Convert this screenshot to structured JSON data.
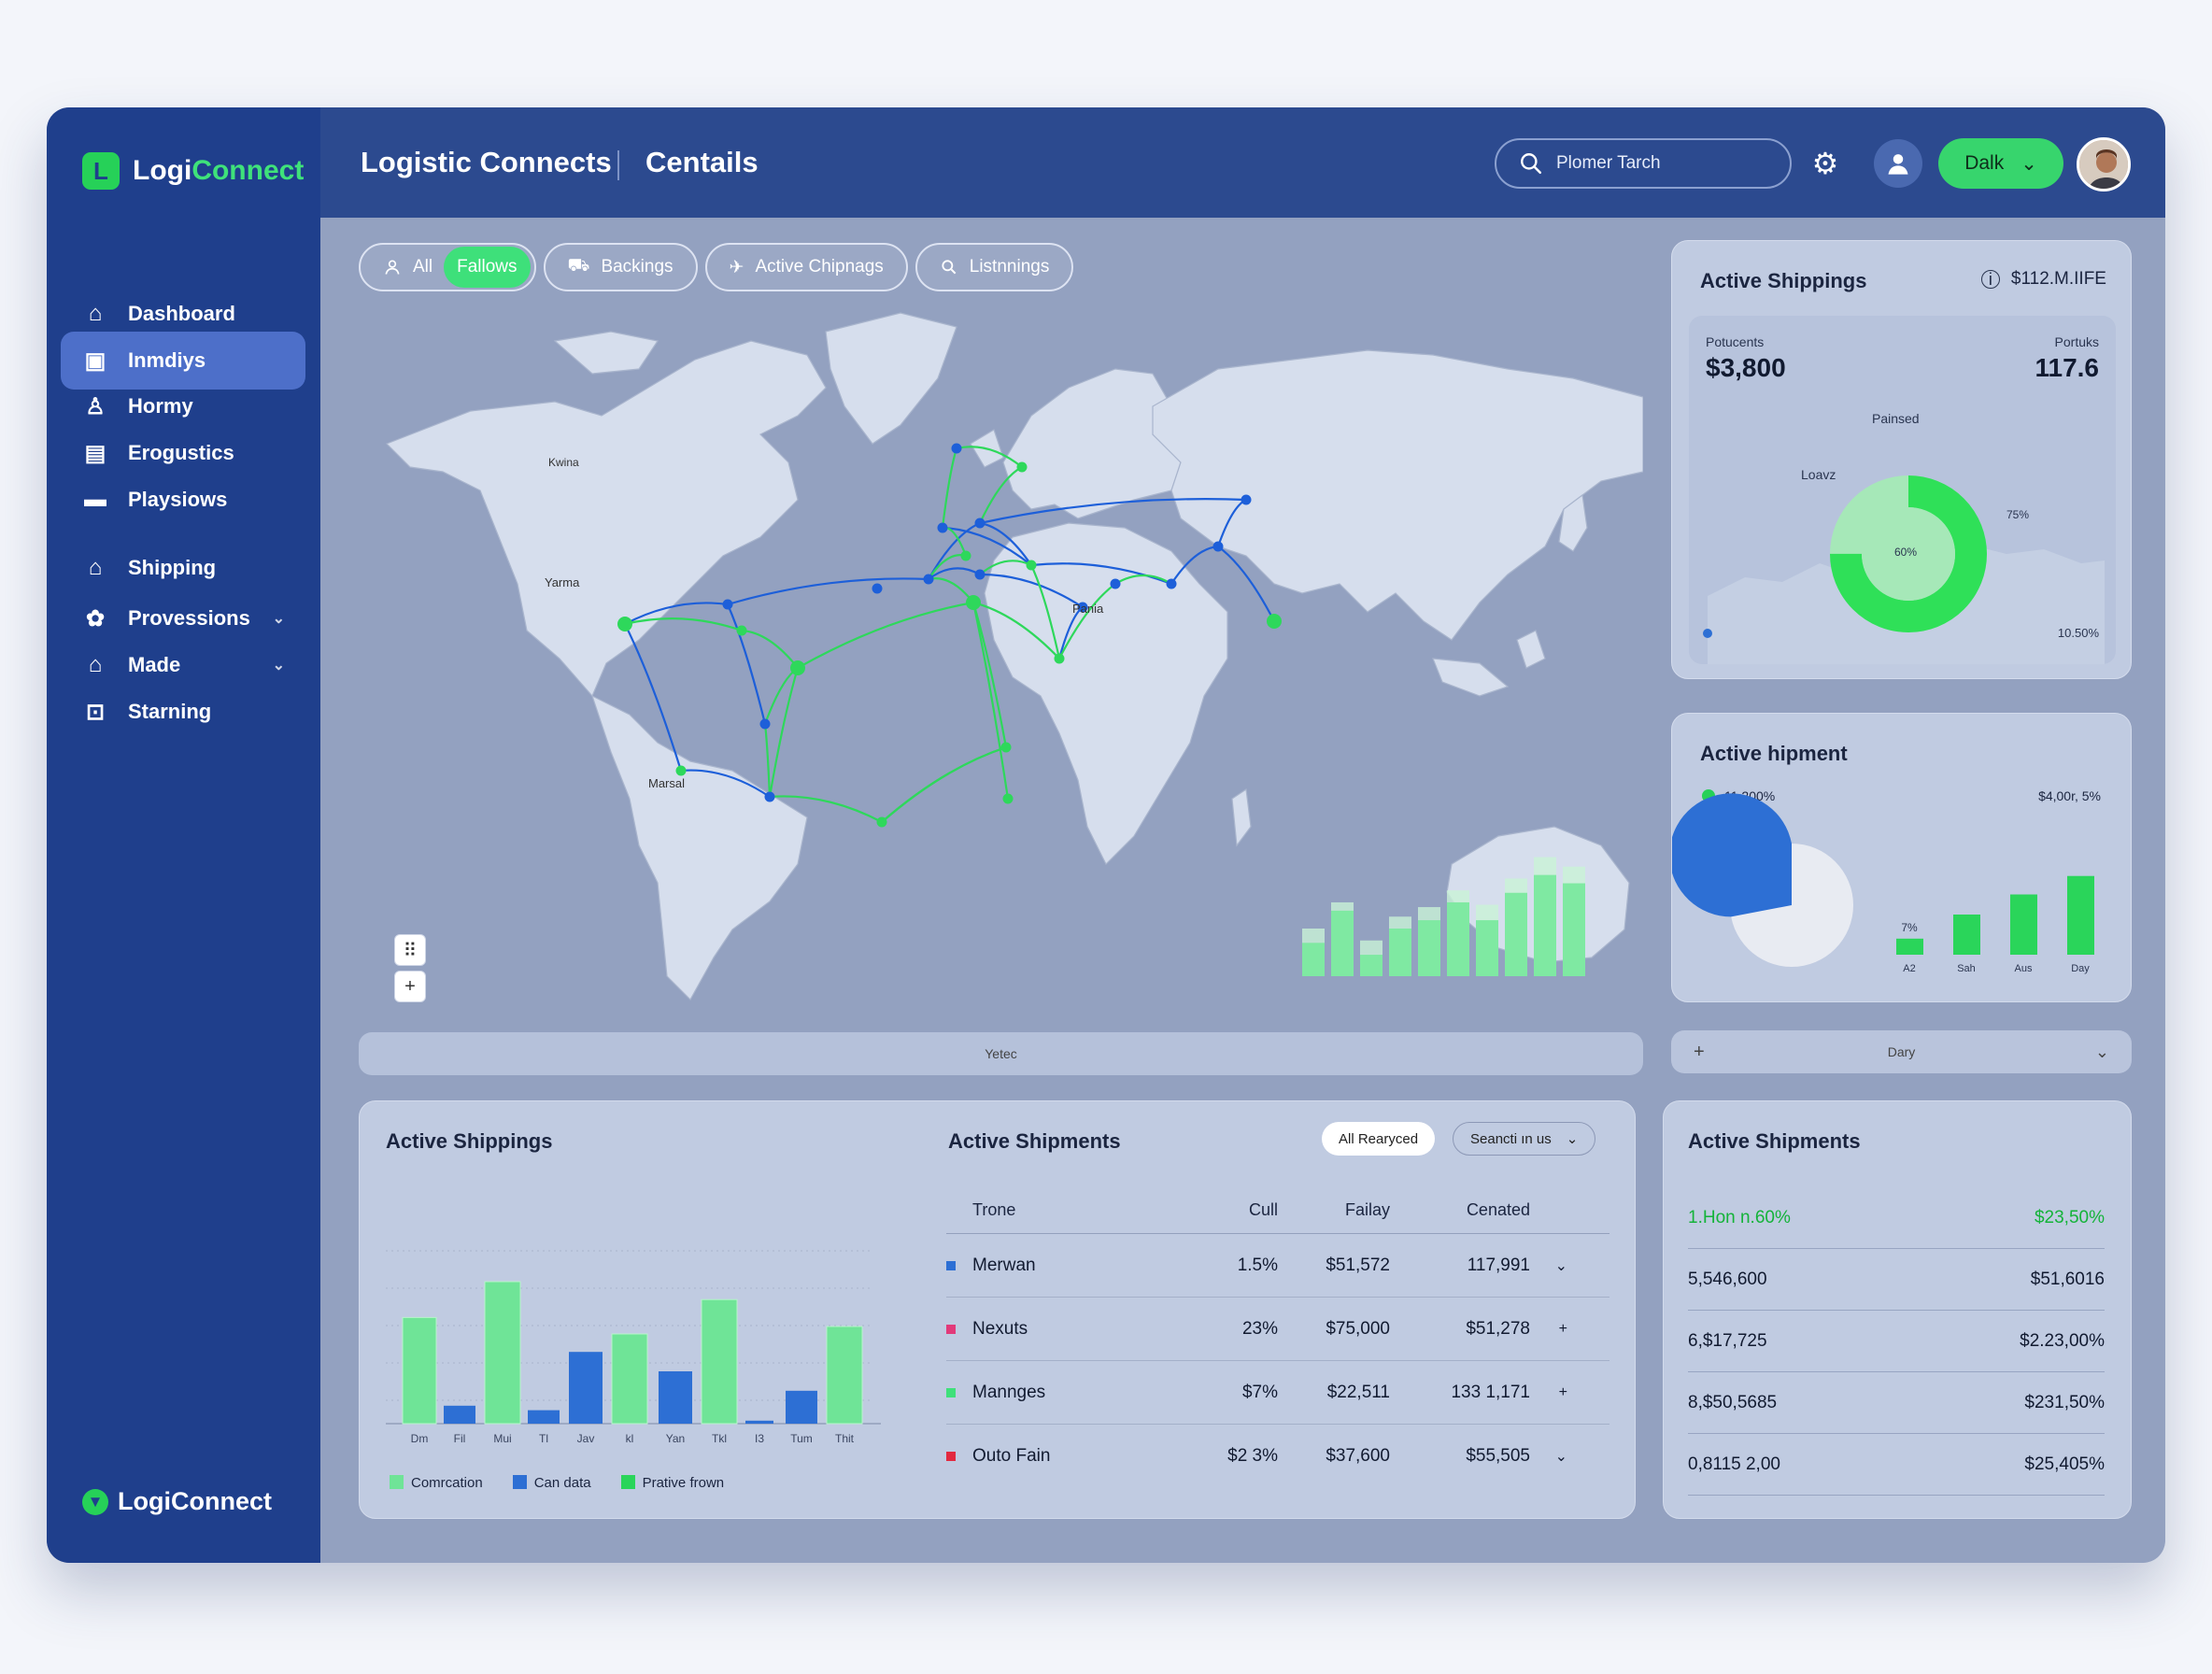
{
  "brand": {
    "name_part1": "Logi",
    "name_part2": "Connect",
    "footer": "LogiConnect"
  },
  "sidebar": {
    "items": [
      {
        "label": "Dashboard",
        "icon": "home-icon"
      },
      {
        "label": "Inmdiys",
        "icon": "inbox-icon",
        "active": true
      },
      {
        "label": "Hormy",
        "icon": "person-icon"
      },
      {
        "label": "Erogustics",
        "icon": "grid-icon"
      },
      {
        "label": "Playsiows",
        "icon": "folder-icon"
      },
      {
        "label": "Shipping",
        "icon": "warehouse-icon"
      },
      {
        "label": "Provessions",
        "icon": "gear-icon",
        "chevron": true
      },
      {
        "label": "Made",
        "icon": "home-icon",
        "chevron": true
      },
      {
        "label": "Starning",
        "icon": "lock-icon"
      }
    ]
  },
  "header": {
    "title": "Logistic Connects",
    "subtitle": "Centails",
    "search_value": "Plomer Tarch",
    "action_label": "Dalk"
  },
  "filters": {
    "all": "All",
    "fallows": "Fallows",
    "backings": "Backings",
    "active_chipnags": "Active Chipnags",
    "listnnings": "Listnnings"
  },
  "map": {
    "labels": {
      "l1": "Yarma",
      "l2": "Pania",
      "l3": "Marsal",
      "l4": "Kwina"
    },
    "footer_label": "Yetec",
    "zoom_in": "+",
    "grid_button": "⠿",
    "mini_bars": [
      0.28,
      0.55,
      0.18,
      0.4,
      0.47,
      0.62,
      0.47,
      0.7,
      0.85,
      0.78
    ],
    "mini_bars_back": [
      0.4,
      0.62,
      0.3,
      0.5,
      0.58,
      0.72,
      0.6,
      0.82,
      1.0,
      0.92
    ],
    "colors": {
      "green": "#2ed85b",
      "blue": "#1d5fd9",
      "land": "#d6deed",
      "water": "#8e9bb8"
    }
  },
  "active_shippings_card": {
    "title": "Active Shippings",
    "value": "$112.M.IIFE",
    "left_label": "Potucents",
    "left_value": "$3,800",
    "right_label": "Portuks",
    "right_value": "117.6",
    "center_label": "Painsed",
    "leave_label": "Loavz",
    "donut_percent": 0.75,
    "donut_center": "60%",
    "donut_right": "75%",
    "bottom_right": "10.50%"
  },
  "active_hipment_card": {
    "title": "Active hipment",
    "legend_value": "11.200%",
    "right_value": "$4,00r, 5%",
    "pie_percent": 0.72,
    "bars": [
      {
        "label": "A2",
        "value": 0.2,
        "top_label": "7%"
      },
      {
        "label": "Sah",
        "value": 0.5
      },
      {
        "label": "Aus",
        "value": 0.75
      },
      {
        "label": "Day",
        "value": 0.98
      }
    ]
  },
  "day_bar": {
    "label": "Dary",
    "plus": "+"
  },
  "bottom_card": {
    "left_title": "Active Shippings",
    "mid_title": "Active Shipments",
    "pill_all": "All Rearyced",
    "pill_search": "Seancti ın us",
    "x_labels": [
      "Dm",
      "Fil",
      "Mui",
      "Tl",
      "Jav",
      "kl",
      "Yan",
      "Tkl",
      "I3",
      "Tum",
      "Thit"
    ],
    "series": [
      {
        "name": "Comrcation",
        "color": "#6fe497"
      },
      {
        "name": "Can data",
        "color": "#2d6fd4"
      },
      {
        "name": "Prative frown",
        "color": "#2ad55a"
      }
    ],
    "bars": [
      {
        "s": 0,
        "v": 0.71
      },
      {
        "s": 1,
        "v": 0.12
      },
      {
        "s": 0,
        "v": 0.95
      },
      {
        "s": 1,
        "v": 0.09
      },
      {
        "s": 1,
        "v": 0.48
      },
      {
        "s": 0,
        "v": 0.6
      },
      {
        "s": 1,
        "v": 0.35
      },
      {
        "s": 0,
        "v": 0.83
      },
      {
        "s": 1,
        "v": 0.02
      },
      {
        "s": 1,
        "v": 0.22
      },
      {
        "s": 0,
        "v": 0.65
      }
    ],
    "table": {
      "headers": [
        "Trone",
        "Cull",
        "Failay",
        "Cenated"
      ],
      "rows": [
        {
          "name": "Merwan",
          "color": "#2d6fd4",
          "c1": "1.5%",
          "c2": "$51,572",
          "c3": "117,991",
          "mark": "⌄"
        },
        {
          "name": "Nexuts",
          "color": "#e23a7a",
          "c1": "23%",
          "c2": "$75,000",
          "c3": "$51,278",
          "mark": "+"
        },
        {
          "name": "Mannges",
          "color": "#3fe07a",
          "c1": "$7%",
          "c2": "$22,511",
          "c3": "133 1,171",
          "mark": "+"
        },
        {
          "name": "Outo Fain",
          "color": "#e2293f",
          "c1": "$2 3%",
          "c2": "$37,600",
          "c3": "$55,505",
          "mark": "⌄"
        }
      ]
    }
  },
  "right_card": {
    "title": "Active Shipments",
    "rows": [
      {
        "left": "1.Hon n.60%",
        "right": "$23,50%",
        "highlight": true
      },
      {
        "left": "5,546,600",
        "right": "$51,6016"
      },
      {
        "left": "6,$17,725",
        "right": "$2.23,00%"
      },
      {
        "left": "8,$50,5685",
        "right": "$231,50%"
      },
      {
        "left": "0,8115 2,00",
        "right": "$25,405%"
      }
    ]
  }
}
